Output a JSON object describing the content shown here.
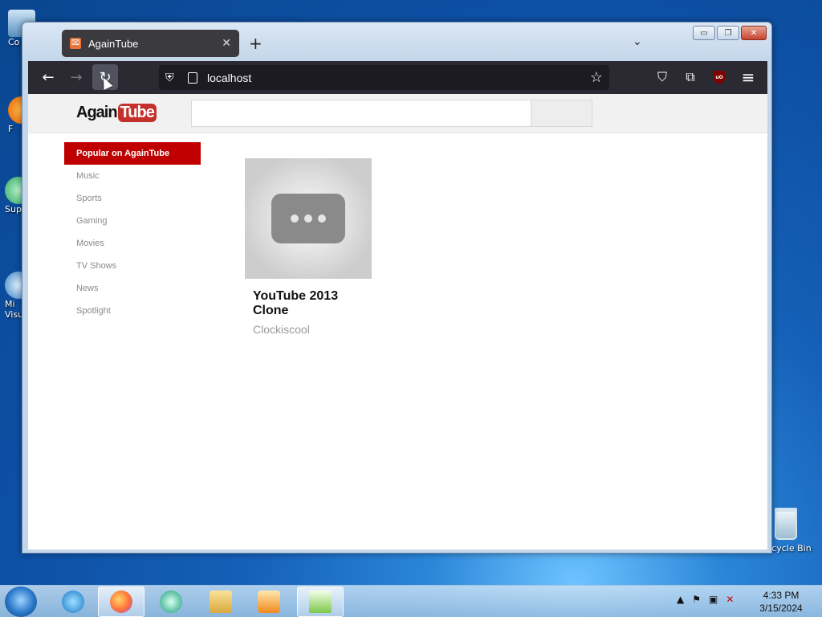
{
  "desktop": {
    "icons": [
      "Co",
      "F",
      "Sup",
      "Mi\nVisu"
    ],
    "recycle_bin": "Recycle Bin"
  },
  "browser": {
    "tab": {
      "title": "AgainTube",
      "close": "✕",
      "favicon": "⌧"
    },
    "new_tab": "+",
    "tab_list": "⌄",
    "window_controls": {
      "minimize": "▭",
      "maximize": "❐",
      "close": "✕"
    },
    "nav": {
      "back": "←",
      "forward": "→",
      "reload": "↻"
    },
    "url": "localhost",
    "tools": {
      "pocket": "⛉",
      "extensions": "⧉",
      "ublock": "uO",
      "menu": "≡"
    }
  },
  "site": {
    "logo": {
      "again": "Again",
      "tube": "Tube"
    },
    "search": {
      "placeholder": ""
    },
    "sidebar": {
      "title": "Popular on AgainTube",
      "items": [
        "Music",
        "Sports",
        "Gaming",
        "Movies",
        "TV Shows",
        "News",
        "Spotlight"
      ]
    },
    "videos": [
      {
        "title": "YouTube 2013 Clone",
        "channel": "Clockiscool"
      }
    ]
  },
  "taskbar": {
    "clock": {
      "time": "4:33 PM",
      "date": "3/15/2024"
    },
    "tray": [
      "▲",
      "⚑",
      "▣",
      "✕"
    ]
  },
  "colors": {
    "brand_red": "#c00000",
    "browser_dark": "#2b2a33",
    "url_bg": "#1c1b22"
  }
}
